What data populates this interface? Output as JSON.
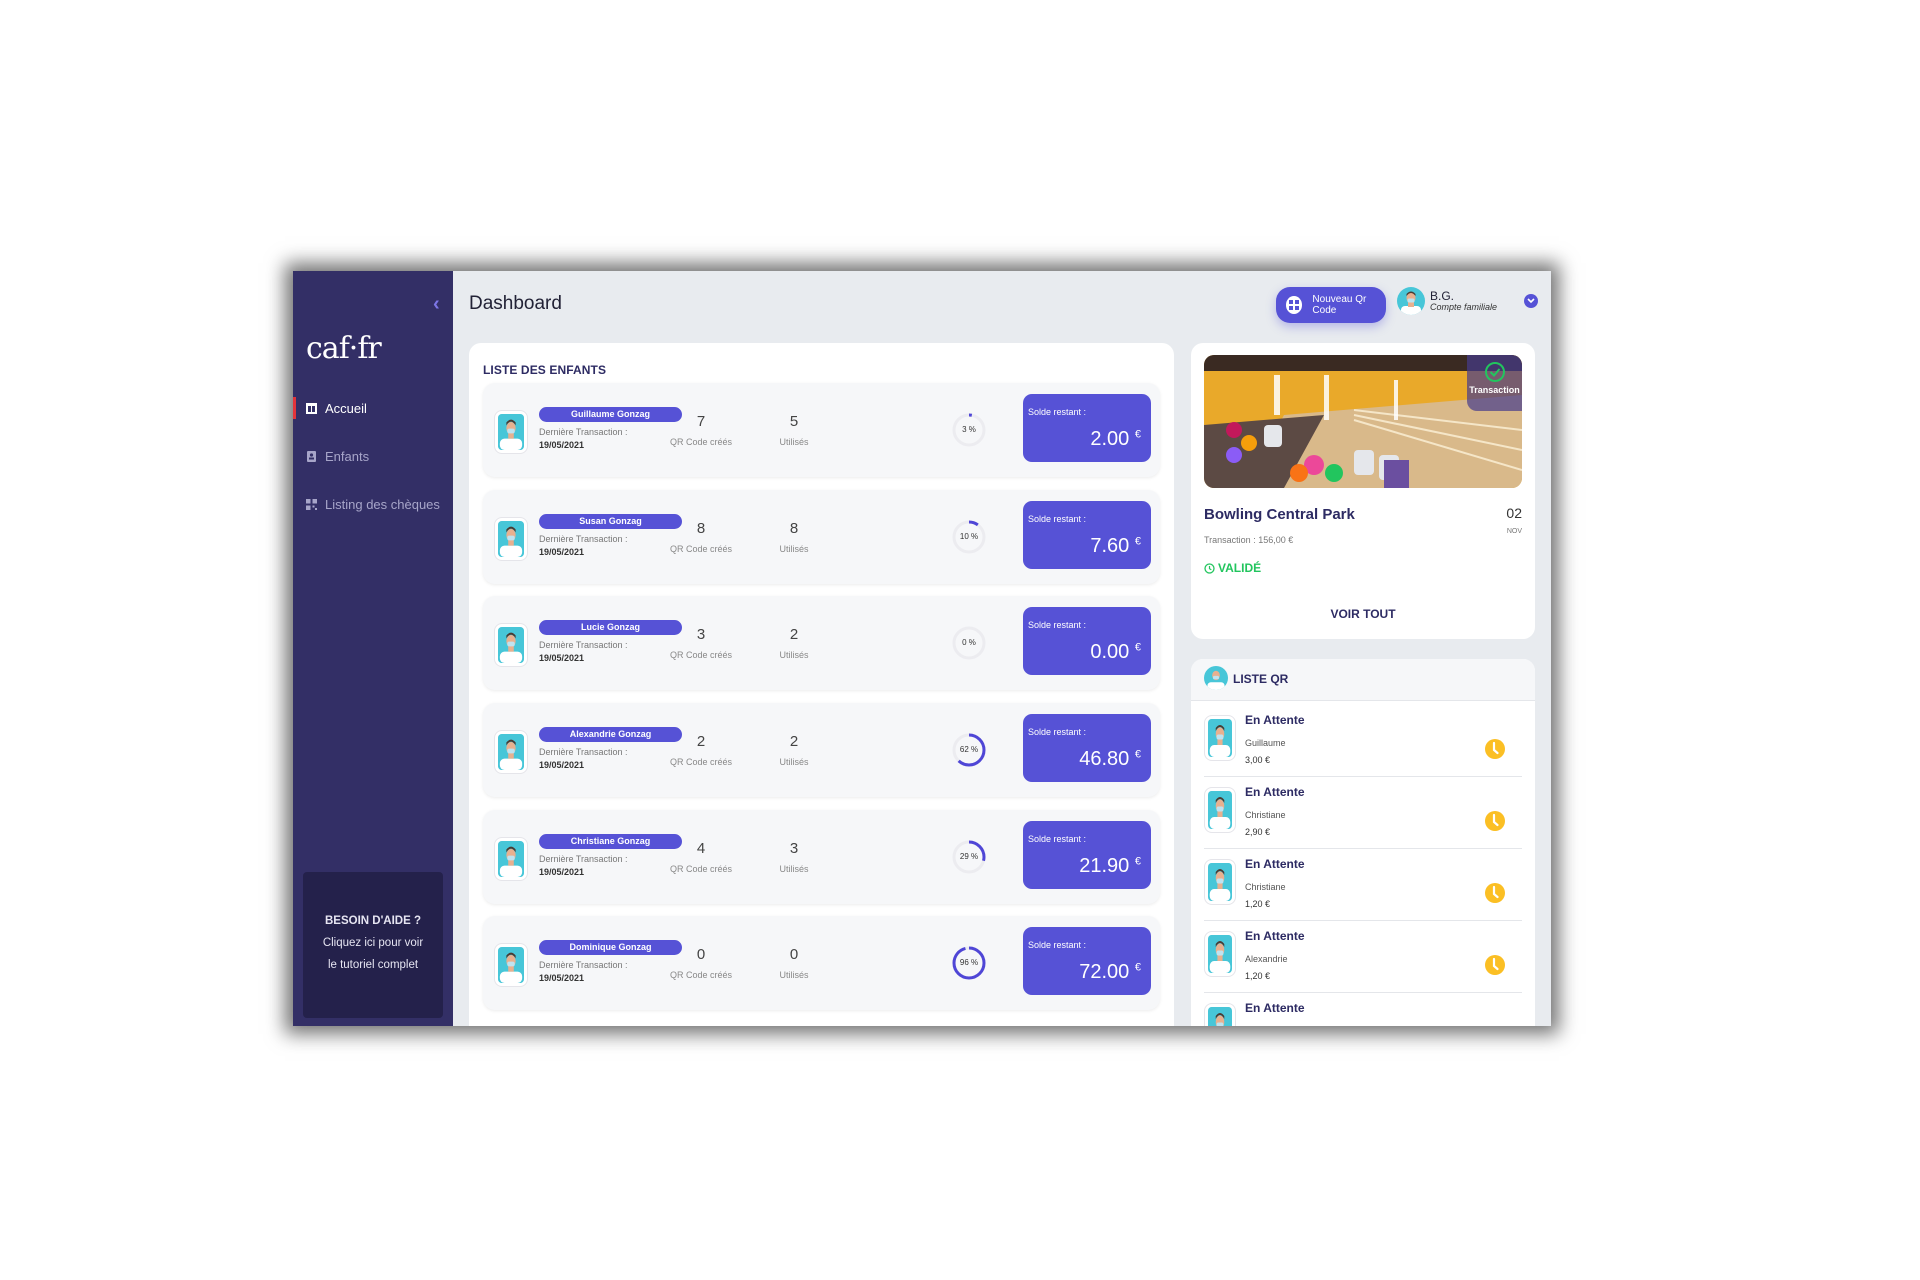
{
  "sidebar": {
    "logo": "caf·fr",
    "collapse_icon": "chevron-left-icon",
    "items": [
      {
        "label": "Accueil",
        "icon": "dashboard-icon",
        "active": true
      },
      {
        "label": "Enfants",
        "icon": "contact-card-icon",
        "active": false
      },
      {
        "label": "Listing des chèques",
        "icon": "qr-grid-icon",
        "active": false
      }
    ],
    "help": {
      "title": "BESOIN D'AIDE ?",
      "line1": "Cliquez ici pour voir",
      "line2": "le tutoriel complet"
    }
  },
  "header": {
    "title": "Dashboard",
    "new_qr_label": "Nouveau Qr Code",
    "user": {
      "initials": "B.G.",
      "role": "Compte familiale"
    }
  },
  "children": {
    "heading": "LISTE DES ENFANTS",
    "last_tx_label": "Dernière Transaction :",
    "qr_created_label": "QR Code créés",
    "used_label": "Utilisés",
    "balance_label": "Solde restant :",
    "currency": "€",
    "rows": [
      {
        "name": "Guillaume Gonzag",
        "last_tx": "19/05/2021",
        "qr_created": "7",
        "used": "5",
        "percent": 3,
        "percent_label": "3 %",
        "balance": "2.00"
      },
      {
        "name": "Susan Gonzag",
        "last_tx": "19/05/2021",
        "qr_created": "8",
        "used": "8",
        "percent": 10,
        "percent_label": "10 %",
        "balance": "7.60"
      },
      {
        "name": "Lucie Gonzag",
        "last_tx": "19/05/2021",
        "qr_created": "3",
        "used": "2",
        "percent": 0,
        "percent_label": "0 %",
        "balance": "0.00"
      },
      {
        "name": "Alexandrie Gonzag",
        "last_tx": "19/05/2021",
        "qr_created": "2",
        "used": "2",
        "percent": 62,
        "percent_label": "62 %",
        "balance": "46.80"
      },
      {
        "name": "Christiane Gonzag",
        "last_tx": "19/05/2021",
        "qr_created": "4",
        "used": "3",
        "percent": 29,
        "percent_label": "29 %",
        "balance": "21.90"
      },
      {
        "name": "Dominique Gonzag",
        "last_tx": "19/05/2021",
        "qr_created": "0",
        "used": "0",
        "percent": 96,
        "percent_label": "96 %",
        "balance": "72.00"
      }
    ]
  },
  "last_transaction": {
    "badge": "Transaction",
    "place": "Bowling Central Park",
    "day": "02",
    "month": "NOV",
    "amount": "Transaction : 156,00 €",
    "status": "VALIDÉ",
    "see_all": "VOIR TOUT"
  },
  "qr_list": {
    "title": "LISTE QR",
    "items": [
      {
        "status": "En Attente",
        "child": "Guillaume",
        "amount": "3,00 €"
      },
      {
        "status": "En Attente",
        "child": "Christiane",
        "amount": "2,90 €"
      },
      {
        "status": "En Attente",
        "child": "Christiane",
        "amount": "1,20 €"
      },
      {
        "status": "En Attente",
        "child": "Alexandrie",
        "amount": "1,20 €"
      },
      {
        "status": "En Attente",
        "child": "",
        "amount": ""
      }
    ]
  },
  "colors": {
    "sidebar": "#332f66",
    "accent": "#5652d6",
    "active_marker": "#e3343b",
    "valid": "#22c55e",
    "pending": "#fbbf24"
  }
}
